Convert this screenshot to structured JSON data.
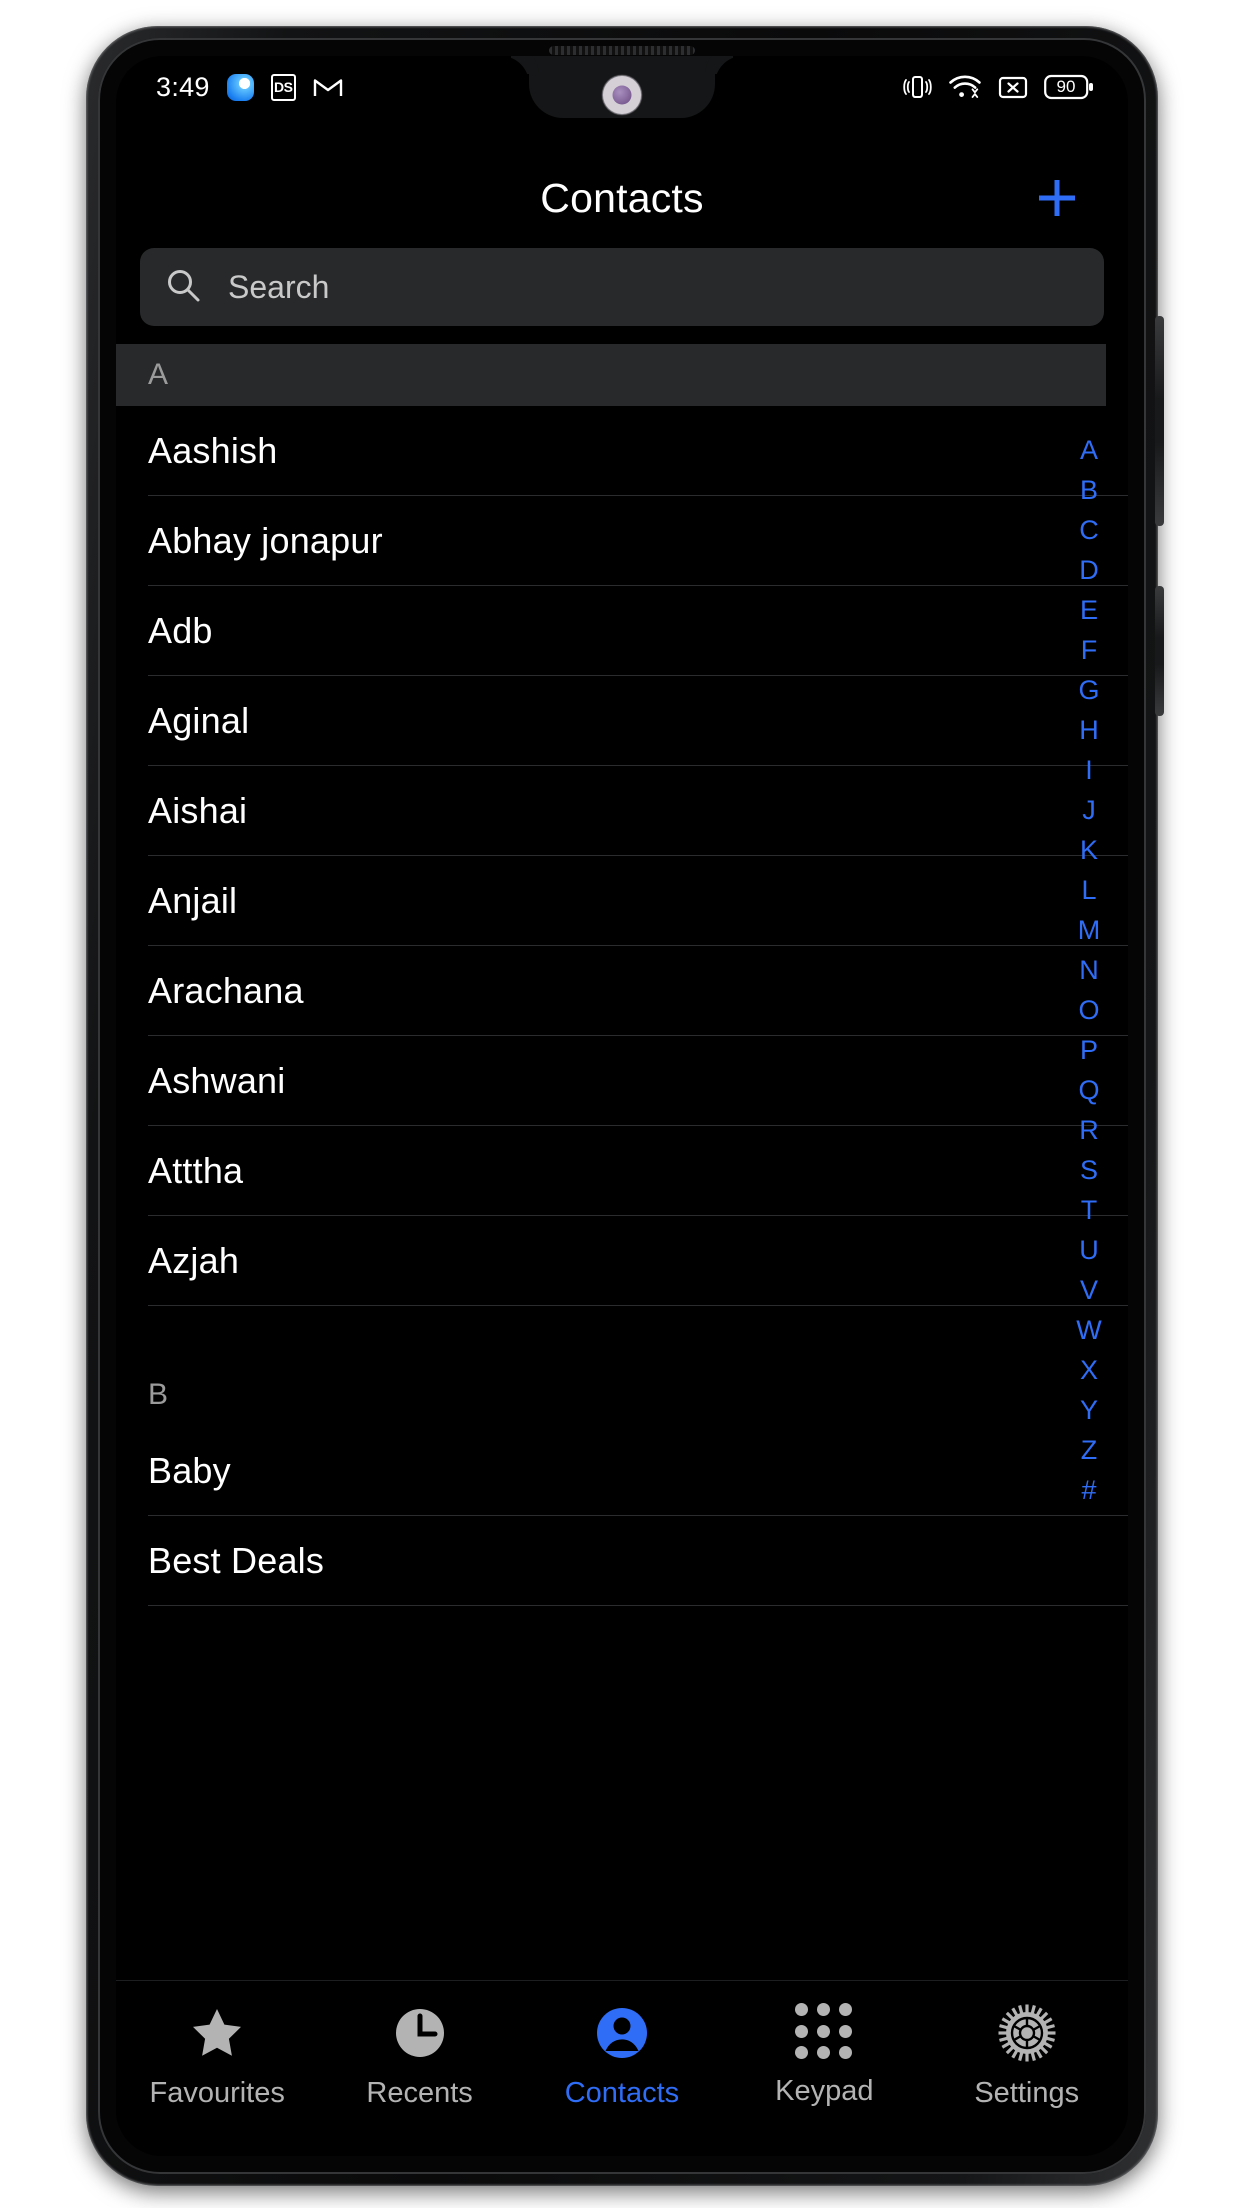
{
  "statusbar": {
    "time": "3:49",
    "icons_left": [
      "app-blue-icon",
      "ds-app-icon",
      "gmail-icon"
    ],
    "ds_label": "DS",
    "icons_right": [
      "vibrate-icon",
      "wifi-icon",
      "no-sim-icon",
      "battery-icon"
    ],
    "battery_level": "90"
  },
  "header": {
    "title": "Contacts",
    "add_icon": "plus-icon"
  },
  "search": {
    "placeholder": "Search",
    "value": "",
    "icon": "search-icon"
  },
  "list": [
    {
      "type": "section",
      "label": "A",
      "banded": true
    },
    {
      "type": "contact",
      "name": "Aashish"
    },
    {
      "type": "contact",
      "name": "Abhay jonapur"
    },
    {
      "type": "contact",
      "name": "Adb"
    },
    {
      "type": "contact",
      "name": "Aginal"
    },
    {
      "type": "contact",
      "name": "Aishai"
    },
    {
      "type": "contact",
      "name": "Anjail"
    },
    {
      "type": "contact",
      "name": "Arachana"
    },
    {
      "type": "contact",
      "name": "Ashwani"
    },
    {
      "type": "contact",
      "name": "Atttha"
    },
    {
      "type": "contact",
      "name": "Azjah"
    },
    {
      "type": "section",
      "label": "B",
      "banded": false
    },
    {
      "type": "contact",
      "name": "Baby"
    },
    {
      "type": "contact",
      "name": "Best Deals"
    }
  ],
  "alpha_index": [
    "A",
    "B",
    "C",
    "D",
    "E",
    "F",
    "G",
    "H",
    "I",
    "J",
    "K",
    "L",
    "M",
    "N",
    "O",
    "P",
    "Q",
    "R",
    "S",
    "T",
    "U",
    "V",
    "W",
    "X",
    "Y",
    "Z",
    "#"
  ],
  "bottom_nav": [
    {
      "label": "Favourites",
      "icon": "star-icon",
      "active": false
    },
    {
      "label": "Recents",
      "icon": "clock-icon",
      "active": false
    },
    {
      "label": "Contacts",
      "icon": "person-icon",
      "active": true
    },
    {
      "label": "Keypad",
      "icon": "keypad-icon",
      "active": false
    },
    {
      "label": "Settings",
      "icon": "gear-icon",
      "active": false
    }
  ],
  "colors": {
    "accent": "#2f6df6",
    "background": "#000000",
    "surface": "#27292b",
    "text_primary": "#ffffff",
    "text_secondary": "#9b9b9c"
  }
}
